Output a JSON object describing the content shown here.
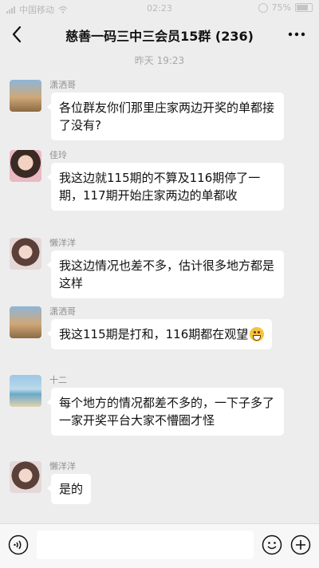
{
  "status_bar": {
    "carrier": "中国移动",
    "time": "02:23",
    "battery": "75%"
  },
  "header": {
    "title": "慈善一码三中三会员15群 (236)",
    "back_icon": "chevron-left-icon",
    "more_icon": "more-dots-icon"
  },
  "chat": {
    "timestamp": "昨天 19:23",
    "messages": [
      {
        "sender": "潇洒哥",
        "text": "各位群友你们那里庄家两边开奖的单都接了没有?"
      },
      {
        "sender": "佳玲",
        "text": "我这边就115期的不算及116期停了一期，117期开始庄家两边的单都收"
      },
      {
        "sender": "懒洋洋",
        "text": "我这边情况也差不多，估计很多地方都是这样"
      },
      {
        "sender": "潇洒哥",
        "text": "我这115期是打和，116期都在观望",
        "emoji": "grin-emoji"
      },
      {
        "sender": "十二",
        "text": "每个地方的情况都差不多的，一下子多了一家开奖平台大家不懵圈才怪"
      },
      {
        "sender": "懒洋洋",
        "text": "是的"
      }
    ]
  },
  "input_bar": {
    "text_value": "",
    "voice_icon": "voice-icon",
    "emoji_icon": "emoji-icon",
    "plus_icon": "plus-icon"
  },
  "colors": {
    "background": "#ededed",
    "bubble": "#ffffff",
    "sent_bubble": "#95ec69"
  }
}
